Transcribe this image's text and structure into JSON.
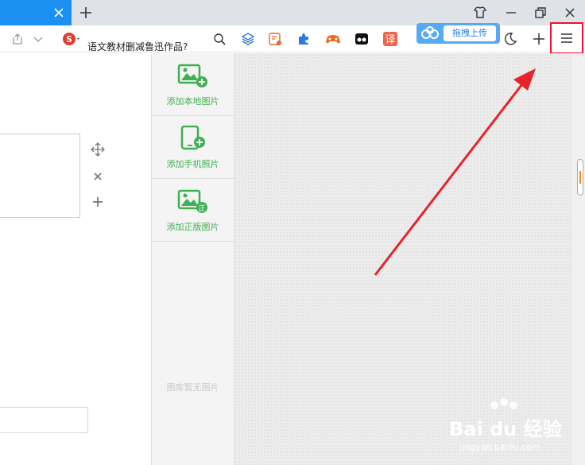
{
  "search": {
    "query": "语文教材删减鲁迅作品?"
  },
  "baidu": {
    "upload_label": "拖拽上传"
  },
  "tooltip": {
    "text": "菜单"
  },
  "panel": {
    "items": [
      {
        "label": "添加本地图片"
      },
      {
        "label": "添加手机照片"
      },
      {
        "label": "添加正版图片"
      }
    ],
    "empty_text": "图库暂无图片"
  },
  "watermark": {
    "brand": "Bai du 经验",
    "url": "jingyan.baidu.com"
  },
  "colors": {
    "accent_blue": "#1c8ff3",
    "green": "#3fb050",
    "red_highlight": "#e13"
  }
}
